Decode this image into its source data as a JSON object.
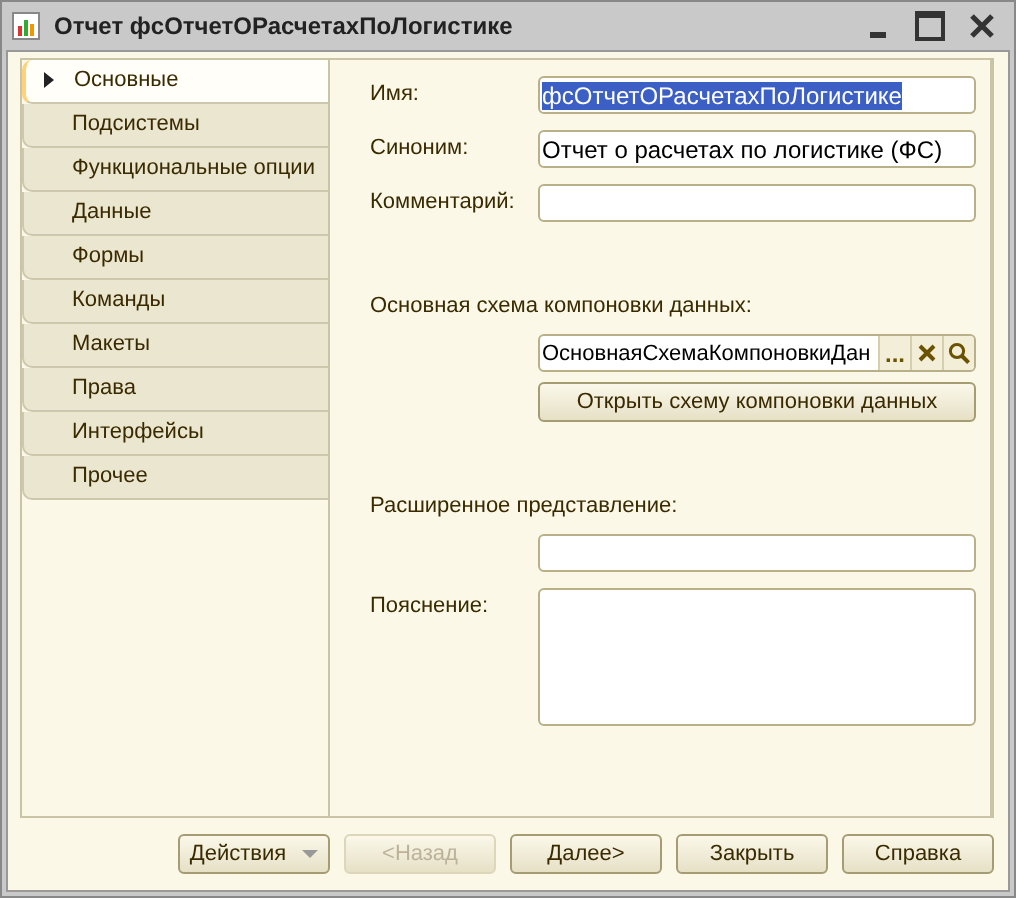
{
  "window": {
    "title": "Отчет фсОтчетОРасчетахПоЛогистике"
  },
  "tabs": [
    {
      "label": "Основные",
      "selected": true
    },
    {
      "label": "Подсистемы",
      "selected": false
    },
    {
      "label": "Функциональные опции",
      "selected": false
    },
    {
      "label": "Данные",
      "selected": false
    },
    {
      "label": "Формы",
      "selected": false
    },
    {
      "label": "Команды",
      "selected": false
    },
    {
      "label": "Макеты",
      "selected": false
    },
    {
      "label": "Права",
      "selected": false
    },
    {
      "label": "Интерфейсы",
      "selected": false
    },
    {
      "label": "Прочее",
      "selected": false
    }
  ],
  "fields": [
    {
      "kind": "text",
      "label": "Имя:",
      "value": "фсОтчетОРасчетахПоЛогистике",
      "highlighted": true
    },
    {
      "kind": "text",
      "label": "Синоним:",
      "value": "Отчет о расчетах по логистике (ФС)",
      "highlighted": false
    },
    {
      "kind": "text",
      "label": "Комментарий:"
    },
    {
      "kind": "gap"
    },
    {
      "kind": "label",
      "label": "Основная схема компоновки данных:"
    },
    {
      "kind": "picker",
      "value": "ОсновнаяСхемаКомпоновкиДан",
      "choose": "..."
    },
    {
      "kind": "button",
      "label": "Открыть схему компоновки данных"
    },
    {
      "kind": "gap"
    },
    {
      "kind": "label",
      "label": "Расширенное представление:"
    },
    {
      "kind": "text"
    },
    {
      "kind": "memo",
      "label": "Пояснение:"
    }
  ],
  "buttons": [
    {
      "label": "Действия",
      "menu": true,
      "disabled": false
    },
    {
      "label": "<Назад",
      "menu": false,
      "disabled": true
    },
    {
      "label": "Далее>",
      "menu": false,
      "disabled": false
    },
    {
      "label": "Закрыть",
      "menu": false,
      "disabled": false
    },
    {
      "label": "Справка",
      "menu": false,
      "disabled": false
    }
  ]
}
